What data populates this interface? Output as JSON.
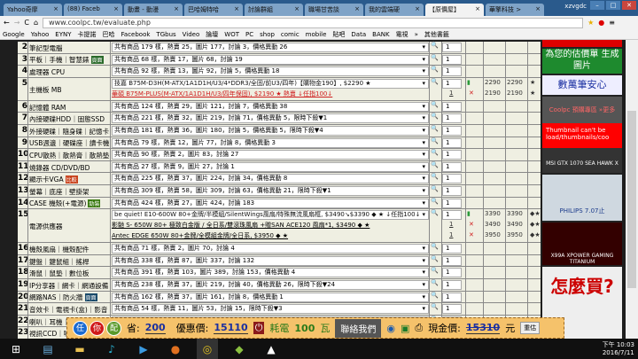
{
  "browser": {
    "tabs": [
      "Yahoo奇摩",
      "(88) Faceb",
      "動畫 - 動漫",
      "巴哈姆特哈",
      "討論群組",
      "職場甘苦談",
      "我的雲端硬",
      "【原價屋】",
      "華擎科技 >"
    ],
    "active_tab": 7,
    "user": "xzvgdc",
    "url": "www.coolpc.tw/evaluate.php",
    "bookmarks": [
      "Google",
      "Yahoo",
      "EYNY",
      "卡提諾",
      "巴哈",
      "Facebook",
      "TGbus",
      "Video",
      "論壇",
      "WOT",
      "PC",
      "shop",
      "comic",
      "mobile",
      "貼吧",
      "Data",
      "BANK",
      "電視",
      "»",
      "其他書籤"
    ]
  },
  "rows": [
    {
      "n": "2",
      "cat": "筆記型電腦",
      "items": [
        "共有商品 179 樣，熱賣 25，圖片 177，討論 3，價格異動 26"
      ],
      "qty": "1"
    },
    {
      "n": "3",
      "cat": "平板｜手機｜智慧錶",
      "tag": "頁面",
      "tagColor": "#2a6a2a",
      "items": [
        "共有商品 68 樣，熱賣 17，圖片 68，討論 19"
      ],
      "qty": "1"
    },
    {
      "n": "4",
      "cat": "處理器 CPU",
      "items": [
        "共有商品 92 樣，熱賣 13，圖片 92，討論 5，價格異動 18"
      ],
      "qty": "1"
    },
    {
      "n": "5",
      "cat": "主機板 MB",
      "items": [
        "技嘉 B75M-D3H(M-ATX/1A1D1H/U3/4*DDR3/全固/前U3/四年)【購物金190】, $2290 ★",
        "華碩 B75M-PLUS(M-ATX/1A1D1H/U3/四年保固), $2190 ★ 熱賣 ↓任指100↓"
      ],
      "qty": "1",
      "alt_qty": [
        "1"
      ],
      "prices": [
        [
          "2290",
          "2290",
          "★"
        ],
        [
          "2190",
          "2190",
          "★"
        ]
      ]
    },
    {
      "n": "6",
      "cat": "記憶體 RAM",
      "items": [
        "共有商品 124 樣，熱賣 29，圖片 121，討論 7，價格異動 38"
      ],
      "qty": "1"
    },
    {
      "n": "7",
      "cat": "內接硬碟HDD｜固態SSD",
      "items": [
        "共有商品 221 樣，熱賣 32，圖片 219，討論 71，價格異動 5，限時下殺▼1"
      ],
      "qty": "1"
    },
    {
      "n": "8",
      "cat": "外接硬碟｜隨身碟｜記憶卡",
      "items": [
        "共有商品 181 樣，熱賣 36，圖片 180，討論 5，價格異動 5，限時下殺▼4"
      ],
      "qty": "1"
    },
    {
      "n": "9",
      "cat": "USB週邊｜硬碟座｜讀卡機",
      "items": [
        "共有商品 79 樣，熱賣 12，圖片 77，討論 8，價格異動 3"
      ],
      "qty": "1"
    },
    {
      "n": "10",
      "cat": "CPU散熱｜散熱膏｜散熱墊",
      "items": [
        "共有商品 90 樣，熱賣 2，圖片 83，討論 27"
      ],
      "qty": "1"
    },
    {
      "n": "11",
      "cat": "燒錄器 CD/DVD/BD",
      "items": [
        "共有商品 27 樣，熱賣 9，圖片 27，討論 1"
      ],
      "qty": "1"
    },
    {
      "n": "12",
      "cat": "顯示卡VGA",
      "tag": "比較",
      "tagColor": "#c8401a",
      "items": [
        "共有商品 225 樣，熱賣 37，圖片 224，討論 34，價格異動 8"
      ],
      "qty": "1"
    },
    {
      "n": "13",
      "cat": "螢幕｜底座｜壁掛架",
      "items": [
        "共有商品 309 樣，熱賣 58，圖片 309，討論 63，價格異動 21，限時下殺▼1"
      ],
      "qty": "1"
    },
    {
      "n": "14",
      "cat": "CASE 機殼(+電源)",
      "tag": "勁裝",
      "tagColor": "#3a7a10",
      "items": [
        "共有商品 424 樣，熱賣 27，圖片 424，討論 183"
      ],
      "qty": "1"
    },
    {
      "n": "15",
      "cat": "電源供應器",
      "items": [
        "be quiet! E10-600W 80+金牌/半模組/SilentWings風扇/特殊無流風扇框, $3490↘$3390 ◆ ★ ↓任指100↓",
        "影馳 S- 650W 80+ 極致白金版 / 全日系/雙滾珠風扇 +贈SAN ACE120 風扇*1, $3490 ◆ ★",
        "Antec EDGE 650W 80+金牌/全模組金牌/全日系, $3950 ◆ ★"
      ],
      "qty": "1",
      "alt_qty": [
        "1",
        "1"
      ],
      "prices": [
        [
          "3390",
          "3390",
          "◆★"
        ],
        [
          "3490",
          "3490",
          "◆★"
        ],
        [
          "3950",
          "3950",
          "◆★"
        ]
      ]
    },
    {
      "n": "16",
      "cat": "機殼風扇｜機殼配件",
      "items": [
        "共有商品 71 樣，熱賣 2，圖片 70，討論 4"
      ],
      "qty": "1"
    },
    {
      "n": "17",
      "cat": "鍵盤｜鍵鼠組｜搖桿",
      "items": [
        "共有商品 338 樣，熱賣 87，圖片 337，討論 132"
      ],
      "qty": "1"
    },
    {
      "n": "18",
      "cat": "滑鼠｜鼠墊｜數位板",
      "items": [
        "共有商品 391 樣，熱賣 103，圖片 389，討論 153，價格異動 4"
      ],
      "qty": "1"
    },
    {
      "n": "19",
      "cat": "IP分享器｜網卡｜網通設備",
      "items": [
        "共有商品 238 樣，熱賣 37，圖片 219，討論 40，價格異動 26，限時下殺▼24"
      ],
      "qty": "1"
    },
    {
      "n": "20",
      "cat": "網路NAS｜防火牆",
      "tag": "頁面",
      "tagColor": "#1a4a6a",
      "items": [
        "共有商品 162 樣，熱賣 37，圖片 161，討論 8，價格異動 1"
      ],
      "qty": "1"
    },
    {
      "n": "21",
      "cat": "音效卡｜電視卡(盒)｜影音",
      "items": [
        "共有商品 54 樣，熱賣 11，圖片 53，討論 15，限時下殺▼3"
      ],
      "qty": "1"
    },
    {
      "n": "22",
      "cat": "喇叭｜耳機｜麥克風",
      "items": [
        "共有商品 85 樣，熱賣 30，圖片 83，討論 31，價格異動 3"
      ],
      "qty": "1"
    },
    {
      "n": "23",
      "cat": "視訊CCD｜嘯叫",
      "items": [
        ""
      ],
      "qty": "1"
    }
  ],
  "ads": {
    "gen_image": "為您的估價單 生成圖片",
    "safe": "數萬筆安心",
    "coolpc": "Coolpc 預購專區 »更多",
    "thumb_err": "Thumbnail can't be load/thumbnails/coo",
    "msi": "MSI GTX 1070 SEA HAWK X",
    "philips": "PHILIPS 7.07止",
    "x99a": "X99A XPOWER GAMING TITANIUM",
    "how": "怎麼買?"
  },
  "bar": {
    "c1": "任",
    "c2": "你",
    "c3": "配",
    "save_label": "省:",
    "save": "200",
    "disc_label": "優惠價:",
    "disc": "15110",
    "power_label": "耗電",
    "power": "100",
    "power_unit": "瓦",
    "contact": "聯絡我們",
    "cash_label": "現金價:",
    "cash": "15310",
    "unit": "元",
    "reset": "重估"
  },
  "clock": {
    "time": "下午 10:03",
    "date": "2016/7/11"
  }
}
